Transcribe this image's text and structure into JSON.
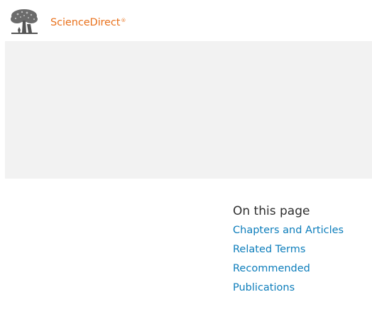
{
  "header": {
    "logo": {
      "icon": "elsevier-tree-icon",
      "brand": "ScienceDirect",
      "brand_mark": "®",
      "brand_color": "#e9711c"
    }
  },
  "hero": {
    "background": "#f2f2f2"
  },
  "toc": {
    "title": "On this page",
    "link_color": "#0c7dbb",
    "items": [
      {
        "label": "Chapters and Articles"
      },
      {
        "label": "Related Terms"
      },
      {
        "label": "Recommended Publications"
      }
    ]
  }
}
